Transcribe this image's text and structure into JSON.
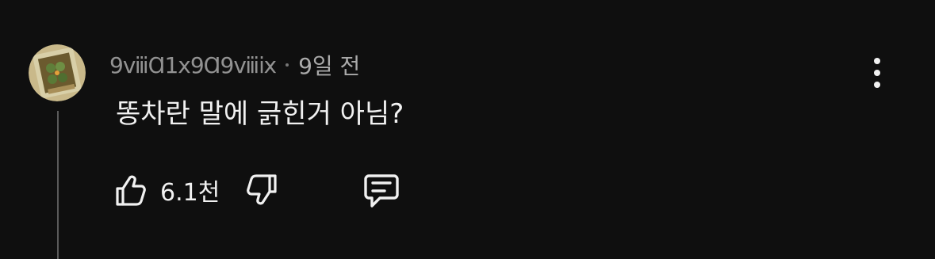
{
  "comment": {
    "author": "9ⅷⱭ1ⅹ9Ɑ9ⅷⅸ",
    "time": "9일 전",
    "text": "똥차란 말에 긁힌거 아님?",
    "like_count": "6.1천",
    "icons": {
      "avatar": "avatar-image",
      "more": "more-vertical-icon",
      "like": "thumbs-up-icon",
      "dislike": "thumbs-down-icon",
      "reply": "reply-comment-icon"
    },
    "colors": {
      "background": "#0f0f0f",
      "primary_text": "#f1f1f1",
      "secondary_text": "#aaaaaa"
    }
  }
}
